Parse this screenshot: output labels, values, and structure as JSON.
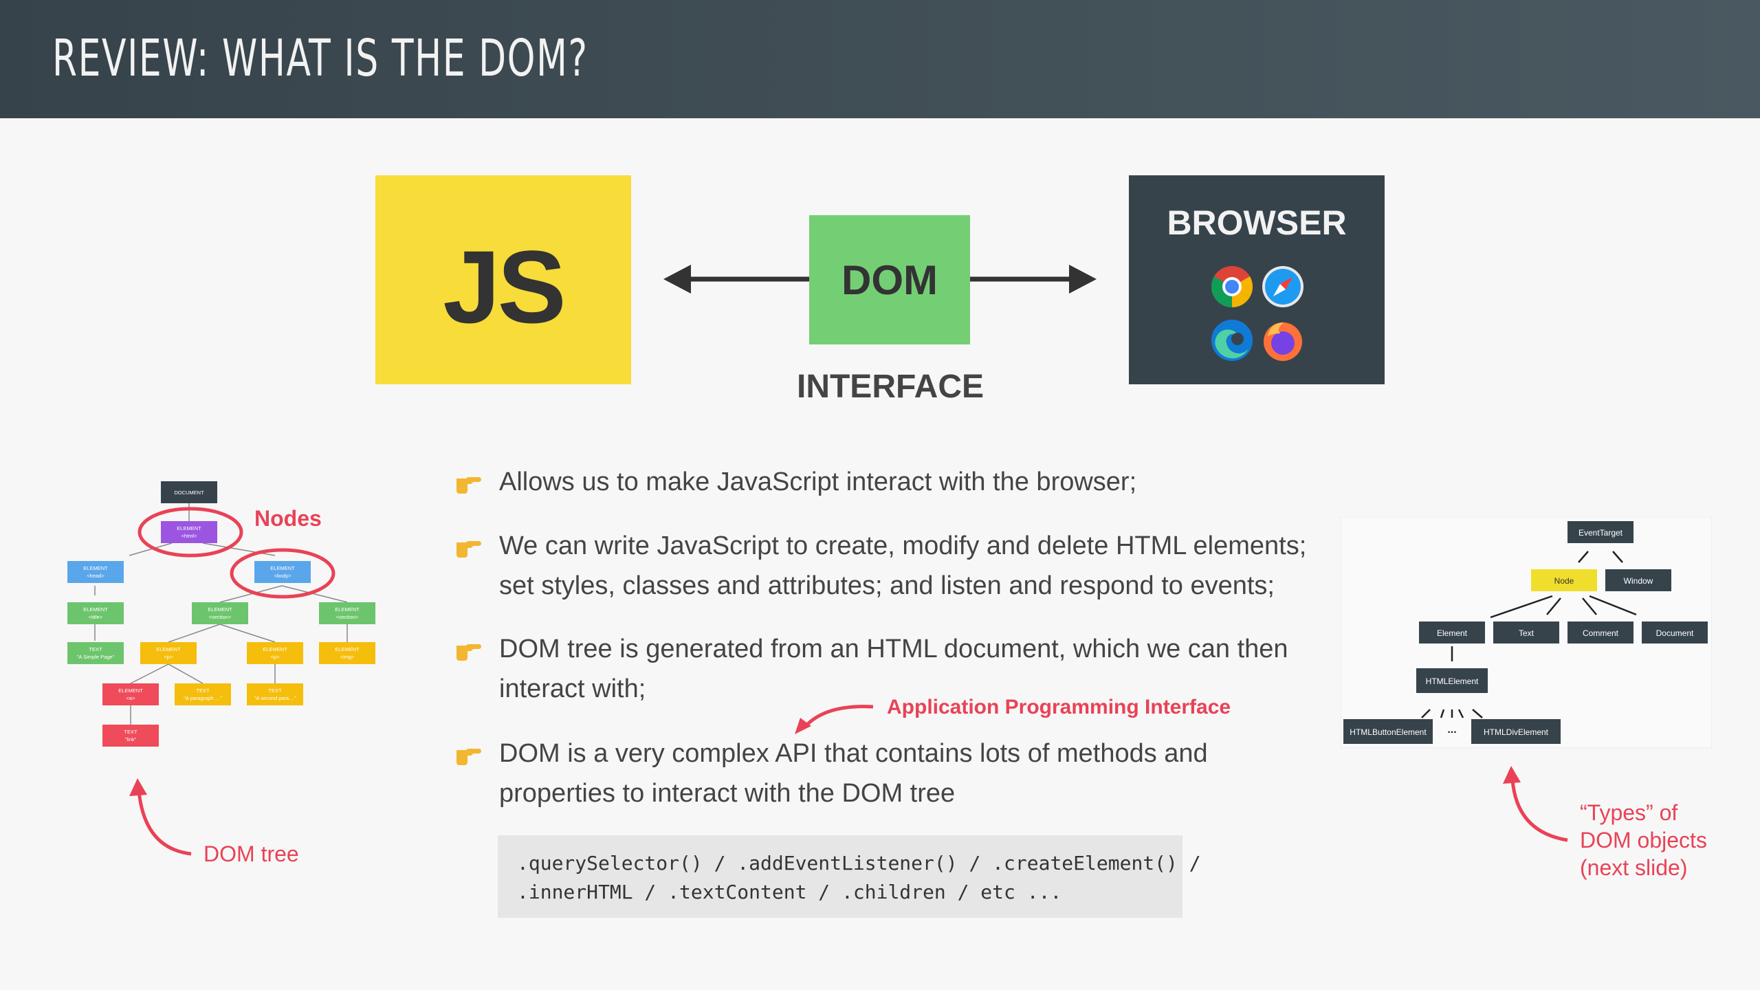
{
  "header": {
    "title": "REVIEW: WHAT IS THE DOM?"
  },
  "diagram": {
    "js_label": "JS",
    "dom_label": "DOM",
    "interface_label": "INTERFACE",
    "browser_label": "BROWSER",
    "browser_icons": [
      "chrome-icon",
      "safari-icon",
      "edge-icon",
      "firefox-icon"
    ]
  },
  "bullets": [
    {
      "lines": [
        "Allows us to make JavaScript interact with the browser;"
      ]
    },
    {
      "lines": [
        "We can write JavaScript to create, modify and delete HTML elements;",
        "set styles, classes and attributes; and listen and respond to events;"
      ]
    },
    {
      "lines": [
        "DOM tree is generated from an HTML document, which we can then",
        "interact with;"
      ]
    },
    {
      "lines": [
        "DOM is a very complex API that contains lots of methods and",
        "properties to interact with the DOM tree"
      ]
    }
  ],
  "code": {
    "line1": ".querySelector() / .addEventListener() / .createElement() /",
    "line2": ".innerHTML / .textContent / .children / etc ..."
  },
  "annotations": {
    "api": "Application Programming Interface",
    "nodes": "Nodes",
    "dom_tree": "DOM tree",
    "types_line1": "“Types” of",
    "types_line2": "DOM objects",
    "types_line3": "(next slide)"
  },
  "dom_tree_nodes": {
    "document": "DOCUMENT",
    "html": [
      "ELEMENT",
      "<html>"
    ],
    "head": [
      "ELEMENT",
      "<head>"
    ],
    "body": [
      "ELEMENT",
      "<body>"
    ],
    "title": [
      "ELEMENT",
      "<title>"
    ],
    "section1": [
      "ELEMENT",
      "<section>"
    ],
    "section2": [
      "ELEMENT",
      "<section>"
    ],
    "text_title": [
      "TEXT",
      "\"A Simple Page\""
    ],
    "p1": [
      "ELEMENT",
      "<p>"
    ],
    "p2": [
      "ELEMENT",
      "<p>"
    ],
    "img": [
      "ELEMENT",
      "<img>"
    ],
    "a": [
      "ELEMENT",
      "<a>"
    ],
    "text_p1": [
      "TEXT",
      "\"A paragraph …\""
    ],
    "text_p2": [
      "TEXT",
      "\"A second para…\""
    ],
    "text_link": [
      "TEXT",
      "\"link\""
    ]
  },
  "type_tree": {
    "event_target": "EventTarget",
    "node": "Node",
    "window": "Window",
    "element": "Element",
    "text": "Text",
    "comment": "Comment",
    "document": "Document",
    "html_element": "HTMLElement",
    "button_element": "HTMLButtonElement",
    "dots": "...",
    "div_element": "HTMLDivElement"
  },
  "colors": {
    "header_bg": "#37434b",
    "js_yellow": "#f7dc3a",
    "dom_green": "#74cf74",
    "browser_dark": "#37434b",
    "accent_red": "#e94256",
    "node_yellow": "#f0de2c"
  }
}
